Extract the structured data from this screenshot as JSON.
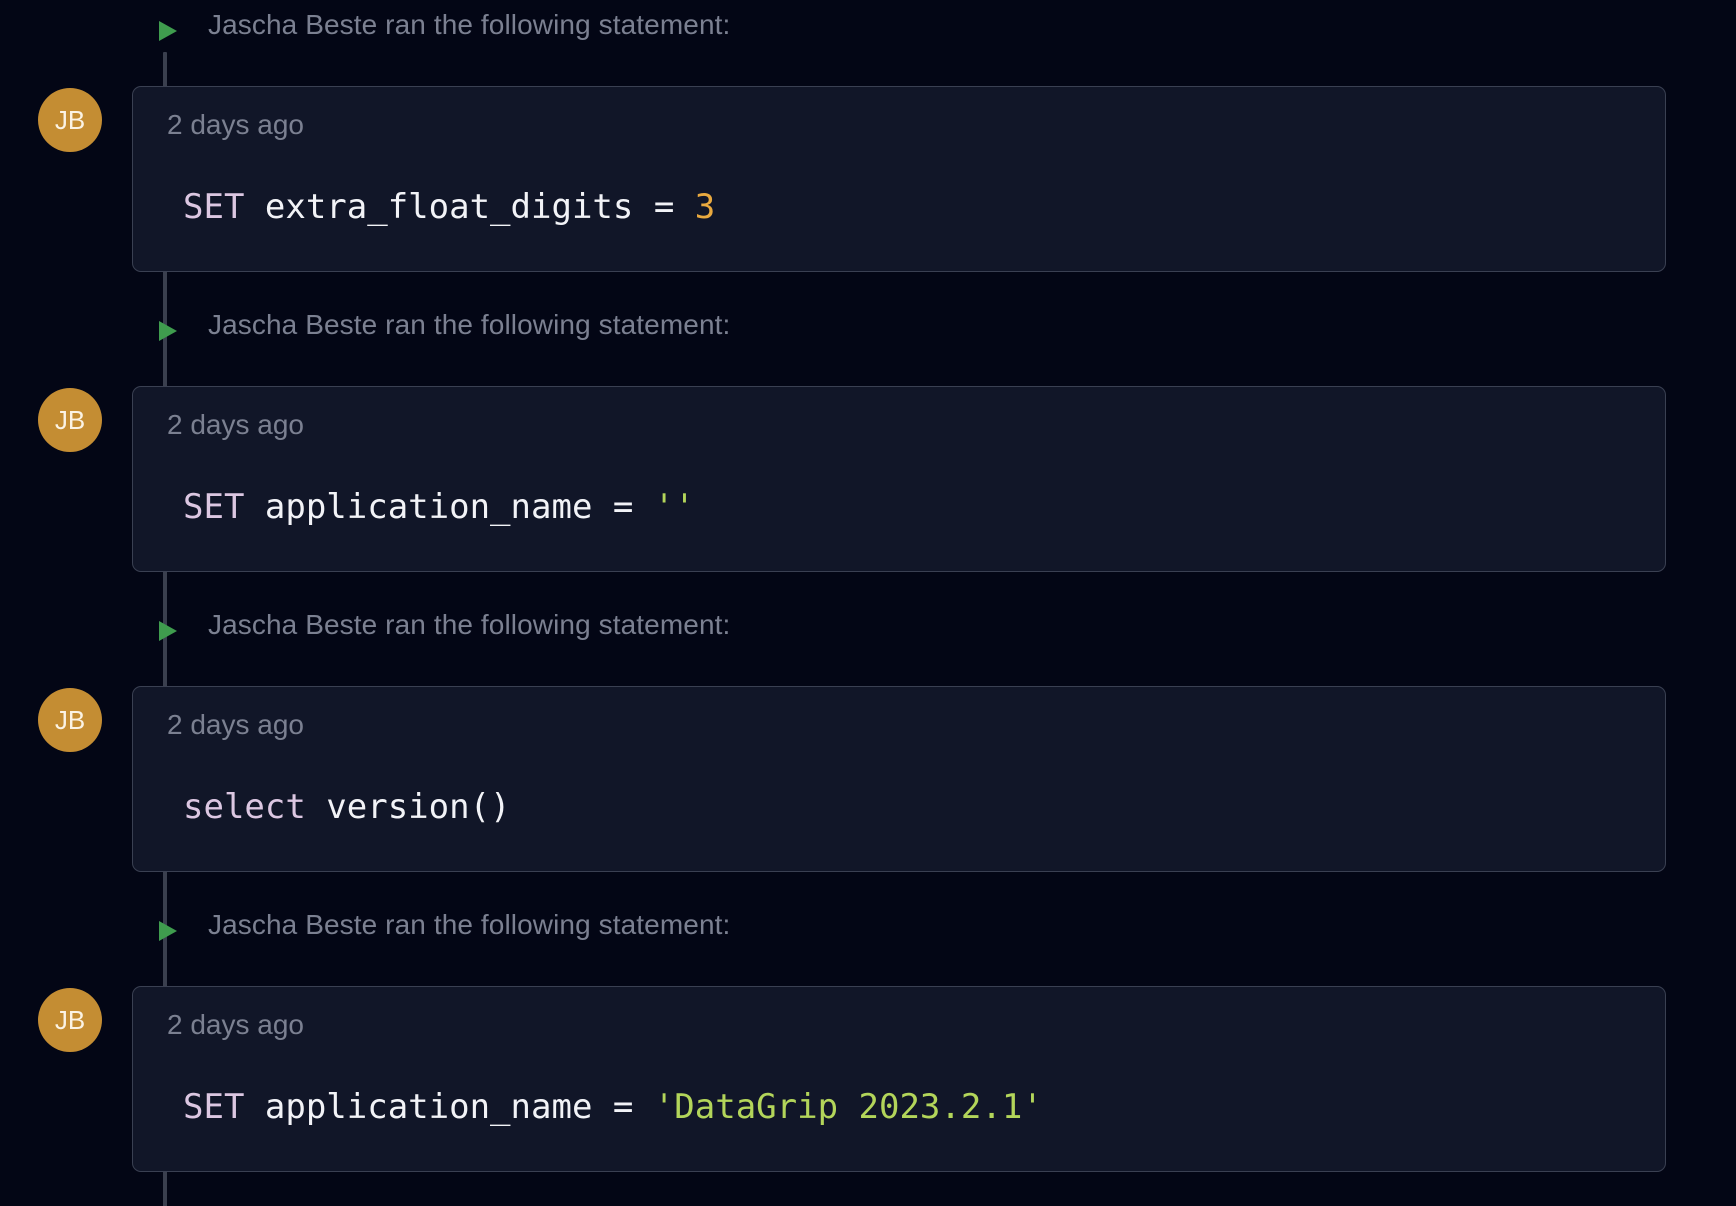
{
  "colors": {
    "background": "#030615",
    "card": "#111628",
    "card_border": "#3a4052",
    "avatar": "#c48d33",
    "run_icon": "#3f9c4e",
    "keyword": "#dcc7e2",
    "number": "#e9a93f",
    "string": "#b3d55a",
    "muted_text": "#7b8091"
  },
  "icons": {
    "run": "play-icon"
  },
  "events": [
    {
      "caption": "Jascha Beste ran the following statement:",
      "avatar_initials": "JB",
      "time": "2 days ago",
      "statement": {
        "keyword": "SET",
        "body": " extra_float_digits = ",
        "literal": "3",
        "literal_type": "number"
      }
    },
    {
      "caption": "Jascha Beste ran the following statement:",
      "avatar_initials": "JB",
      "time": "2 days ago",
      "statement": {
        "keyword": "SET",
        "body": " application_name = ",
        "literal": "''",
        "literal_type": "string"
      }
    },
    {
      "caption": "Jascha Beste ran the following statement:",
      "avatar_initials": "JB",
      "time": "2 days ago",
      "statement": {
        "keyword": "select",
        "body": " version()",
        "literal": "",
        "literal_type": ""
      }
    },
    {
      "caption": "Jascha Beste ran the following statement:",
      "avatar_initials": "JB",
      "time": "2 days ago",
      "statement": {
        "keyword": "SET",
        "body": " application_name = ",
        "literal": "'DataGrip 2023.2.1'",
        "literal_type": "string"
      }
    }
  ]
}
